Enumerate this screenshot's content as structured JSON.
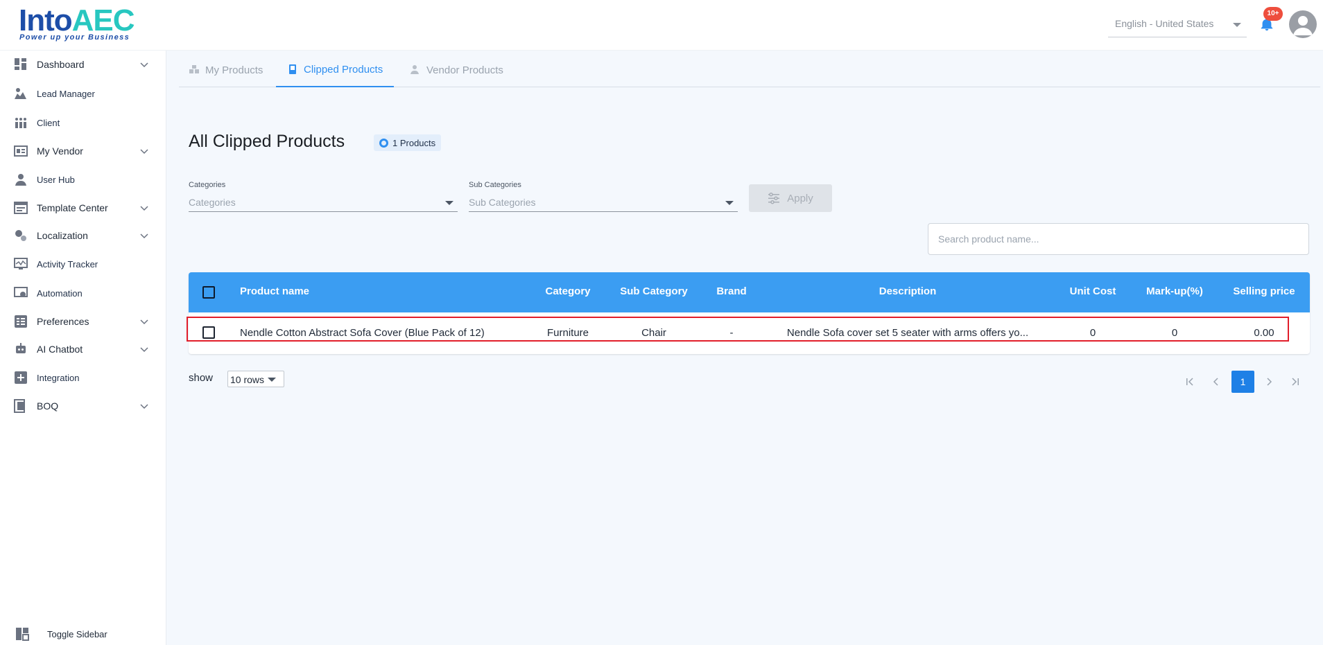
{
  "brand": {
    "logo_part1": "Into",
    "logo_part2": "AEC",
    "tagline": "Power up your Business"
  },
  "header": {
    "language": "English - United States",
    "notification_count": "10+"
  },
  "sidebar": {
    "items": [
      {
        "label": "Dashboard",
        "icon": "dashboard-icon",
        "expandable": true
      },
      {
        "label": "Lead Manager",
        "icon": "lead-manager-icon",
        "expandable": false
      },
      {
        "label": "Client",
        "icon": "client-icon",
        "expandable": false
      },
      {
        "label": "My Vendor",
        "icon": "vendor-icon",
        "expandable": true
      },
      {
        "label": "User Hub",
        "icon": "user-icon",
        "expandable": false
      },
      {
        "label": "Template Center",
        "icon": "template-icon",
        "expandable": true
      },
      {
        "label": "Localization",
        "icon": "localization-icon",
        "expandable": true
      },
      {
        "label": "Activity Tracker",
        "icon": "activity-icon",
        "expandable": false
      },
      {
        "label": "Automation",
        "icon": "automation-icon",
        "expandable": false
      },
      {
        "label": "Preferences",
        "icon": "preferences-icon",
        "expandable": true
      },
      {
        "label": "AI Chatbot",
        "icon": "chatbot-icon",
        "expandable": true
      },
      {
        "label": "Integration",
        "icon": "integration-icon",
        "expandable": false
      },
      {
        "label": "BOQ",
        "icon": "boq-icon",
        "expandable": true
      }
    ],
    "toggle_label": "Toggle Sidebar"
  },
  "tabs": [
    {
      "label": "My Products",
      "active": false
    },
    {
      "label": "Clipped Products",
      "active": true
    },
    {
      "label": "Vendor Products",
      "active": false
    }
  ],
  "page": {
    "title": "All Clipped Products",
    "count_label": "1 Products"
  },
  "filters": {
    "categories_label": "Categories",
    "categories_placeholder": "Categories",
    "subcategories_label": "Sub Categories",
    "subcategories_placeholder": "Sub Categories",
    "apply_label": "Apply"
  },
  "search": {
    "placeholder": "Search product name..."
  },
  "table": {
    "columns": [
      "Product name",
      "Category",
      "Sub Category",
      "Brand",
      "Description",
      "Unit Cost",
      "Mark-up(%)",
      "Selling price"
    ],
    "rows": [
      {
        "product_name": "Nendle Cotton Abstract Sofa Cover  (Blue Pack of 12)",
        "category": "Furniture",
        "sub_category": "Chair",
        "brand": "-",
        "description": "Nendle Sofa cover set 5 seater with arms offers yo...",
        "unit_cost": "0",
        "markup": "0",
        "selling_price": "0.00"
      }
    ]
  },
  "pagination": {
    "show_label": "show",
    "rows_per_page": "10 rows",
    "current_page": "1"
  },
  "colors": {
    "primary": "#3b9df2",
    "accent": "#2f8ff0",
    "badge": "#ee4e3d",
    "highlight": "#e11d2a"
  }
}
